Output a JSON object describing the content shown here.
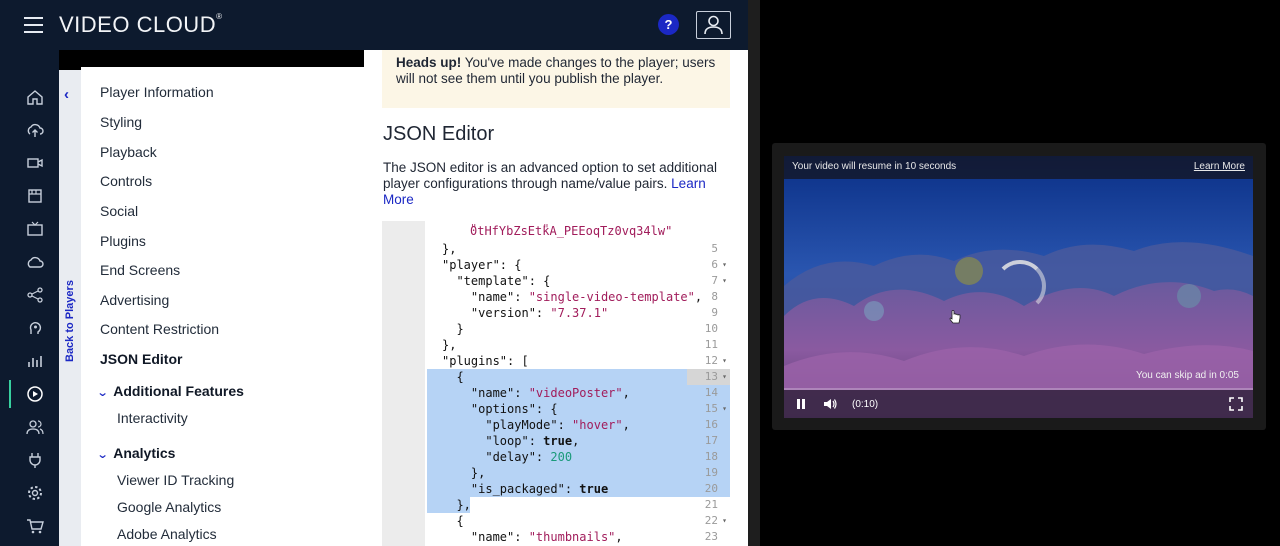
{
  "app": {
    "brand": "VIDEO CLOUD",
    "help_label": "?"
  },
  "rail": {
    "items": [
      "home-icon",
      "upload-icon",
      "video-camera-icon",
      "film-icon",
      "tv-icon",
      "cloud-icon",
      "share-icon",
      "audience-icon",
      "analytics-icon",
      "players-icon",
      "users-icon",
      "plug-icon",
      "gear-icon",
      "cart-icon"
    ],
    "active": "players-icon"
  },
  "sidebar": {
    "back_label": "Back to Players",
    "items": [
      "Player Information",
      "Styling",
      "Playback",
      "Controls",
      "Social",
      "Plugins",
      "End Screens",
      "Advertising",
      "Content Restriction"
    ],
    "active_item": "JSON Editor",
    "groups": [
      {
        "label": "Additional Features",
        "items": [
          "Interactivity"
        ]
      },
      {
        "label": "Analytics",
        "items": [
          "Viewer ID Tracking",
          "Google Analytics",
          "Adobe Analytics"
        ]
      }
    ]
  },
  "main": {
    "alert_strong": "Heads up!",
    "alert_text": " You've made changes to the player; users will not see them until you publish the player.",
    "title": "JSON Editor",
    "description": "The JSON editor is an advanced option to set additional player configurations through name/value pairs. ",
    "learn_more": "Learn More",
    "editor": {
      "top_fragment": "0tHfYbZsEtkA_PEEoqTz0vq34lw\"",
      "line_numbers": [
        "5",
        "6",
        "7",
        "8",
        "9",
        "10",
        "11",
        "12",
        "13",
        "14",
        "15",
        "16",
        "17",
        "18",
        "19",
        "20",
        "21",
        "22",
        "23"
      ],
      "lines": [
        "},",
        "\"player\": {",
        "  \"template\": {",
        "    \"name\": \"single-video-template\",",
        "    \"version\": \"7.37.1\"",
        "  }",
        "},",
        "\"plugins\": [",
        "  {",
        "    \"name\": \"videoPoster\",",
        "    \"options\": {",
        "      \"playMode\": \"hover\",",
        "      \"loop\": true,",
        "      \"delay\": 200",
        "    },",
        "    \"is_packaged\": true",
        "  },",
        "  {",
        "    \"name\": \"thumbnails\","
      ]
    }
  },
  "player": {
    "ad_resume": "Your video will resume in 10 seconds",
    "ad_learn_more": "Learn More",
    "skip_text": "You can skip ad in 0:05",
    "time": "(0:10)"
  }
}
